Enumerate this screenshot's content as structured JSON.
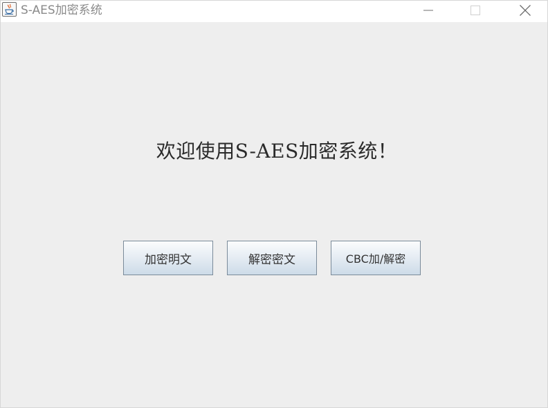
{
  "window": {
    "title": "S-AES加密系统",
    "controls": {
      "minimize_icon": "minimize-icon",
      "maximize_icon": "maximize-icon",
      "close_icon": "close-icon"
    }
  },
  "main": {
    "welcome": "欢迎使用S-AES加密系统！",
    "buttons": {
      "encrypt_label": "加密明文",
      "decrypt_label": "解密密文",
      "cbc_label": "CBC加/解密"
    }
  },
  "colors": {
    "background": "#eeeeee",
    "titlebar": "#ffffff",
    "button_gradient_top": "#fbfcfd",
    "button_gradient_bottom": "#cddbe8",
    "button_border": "#7a8a99"
  }
}
